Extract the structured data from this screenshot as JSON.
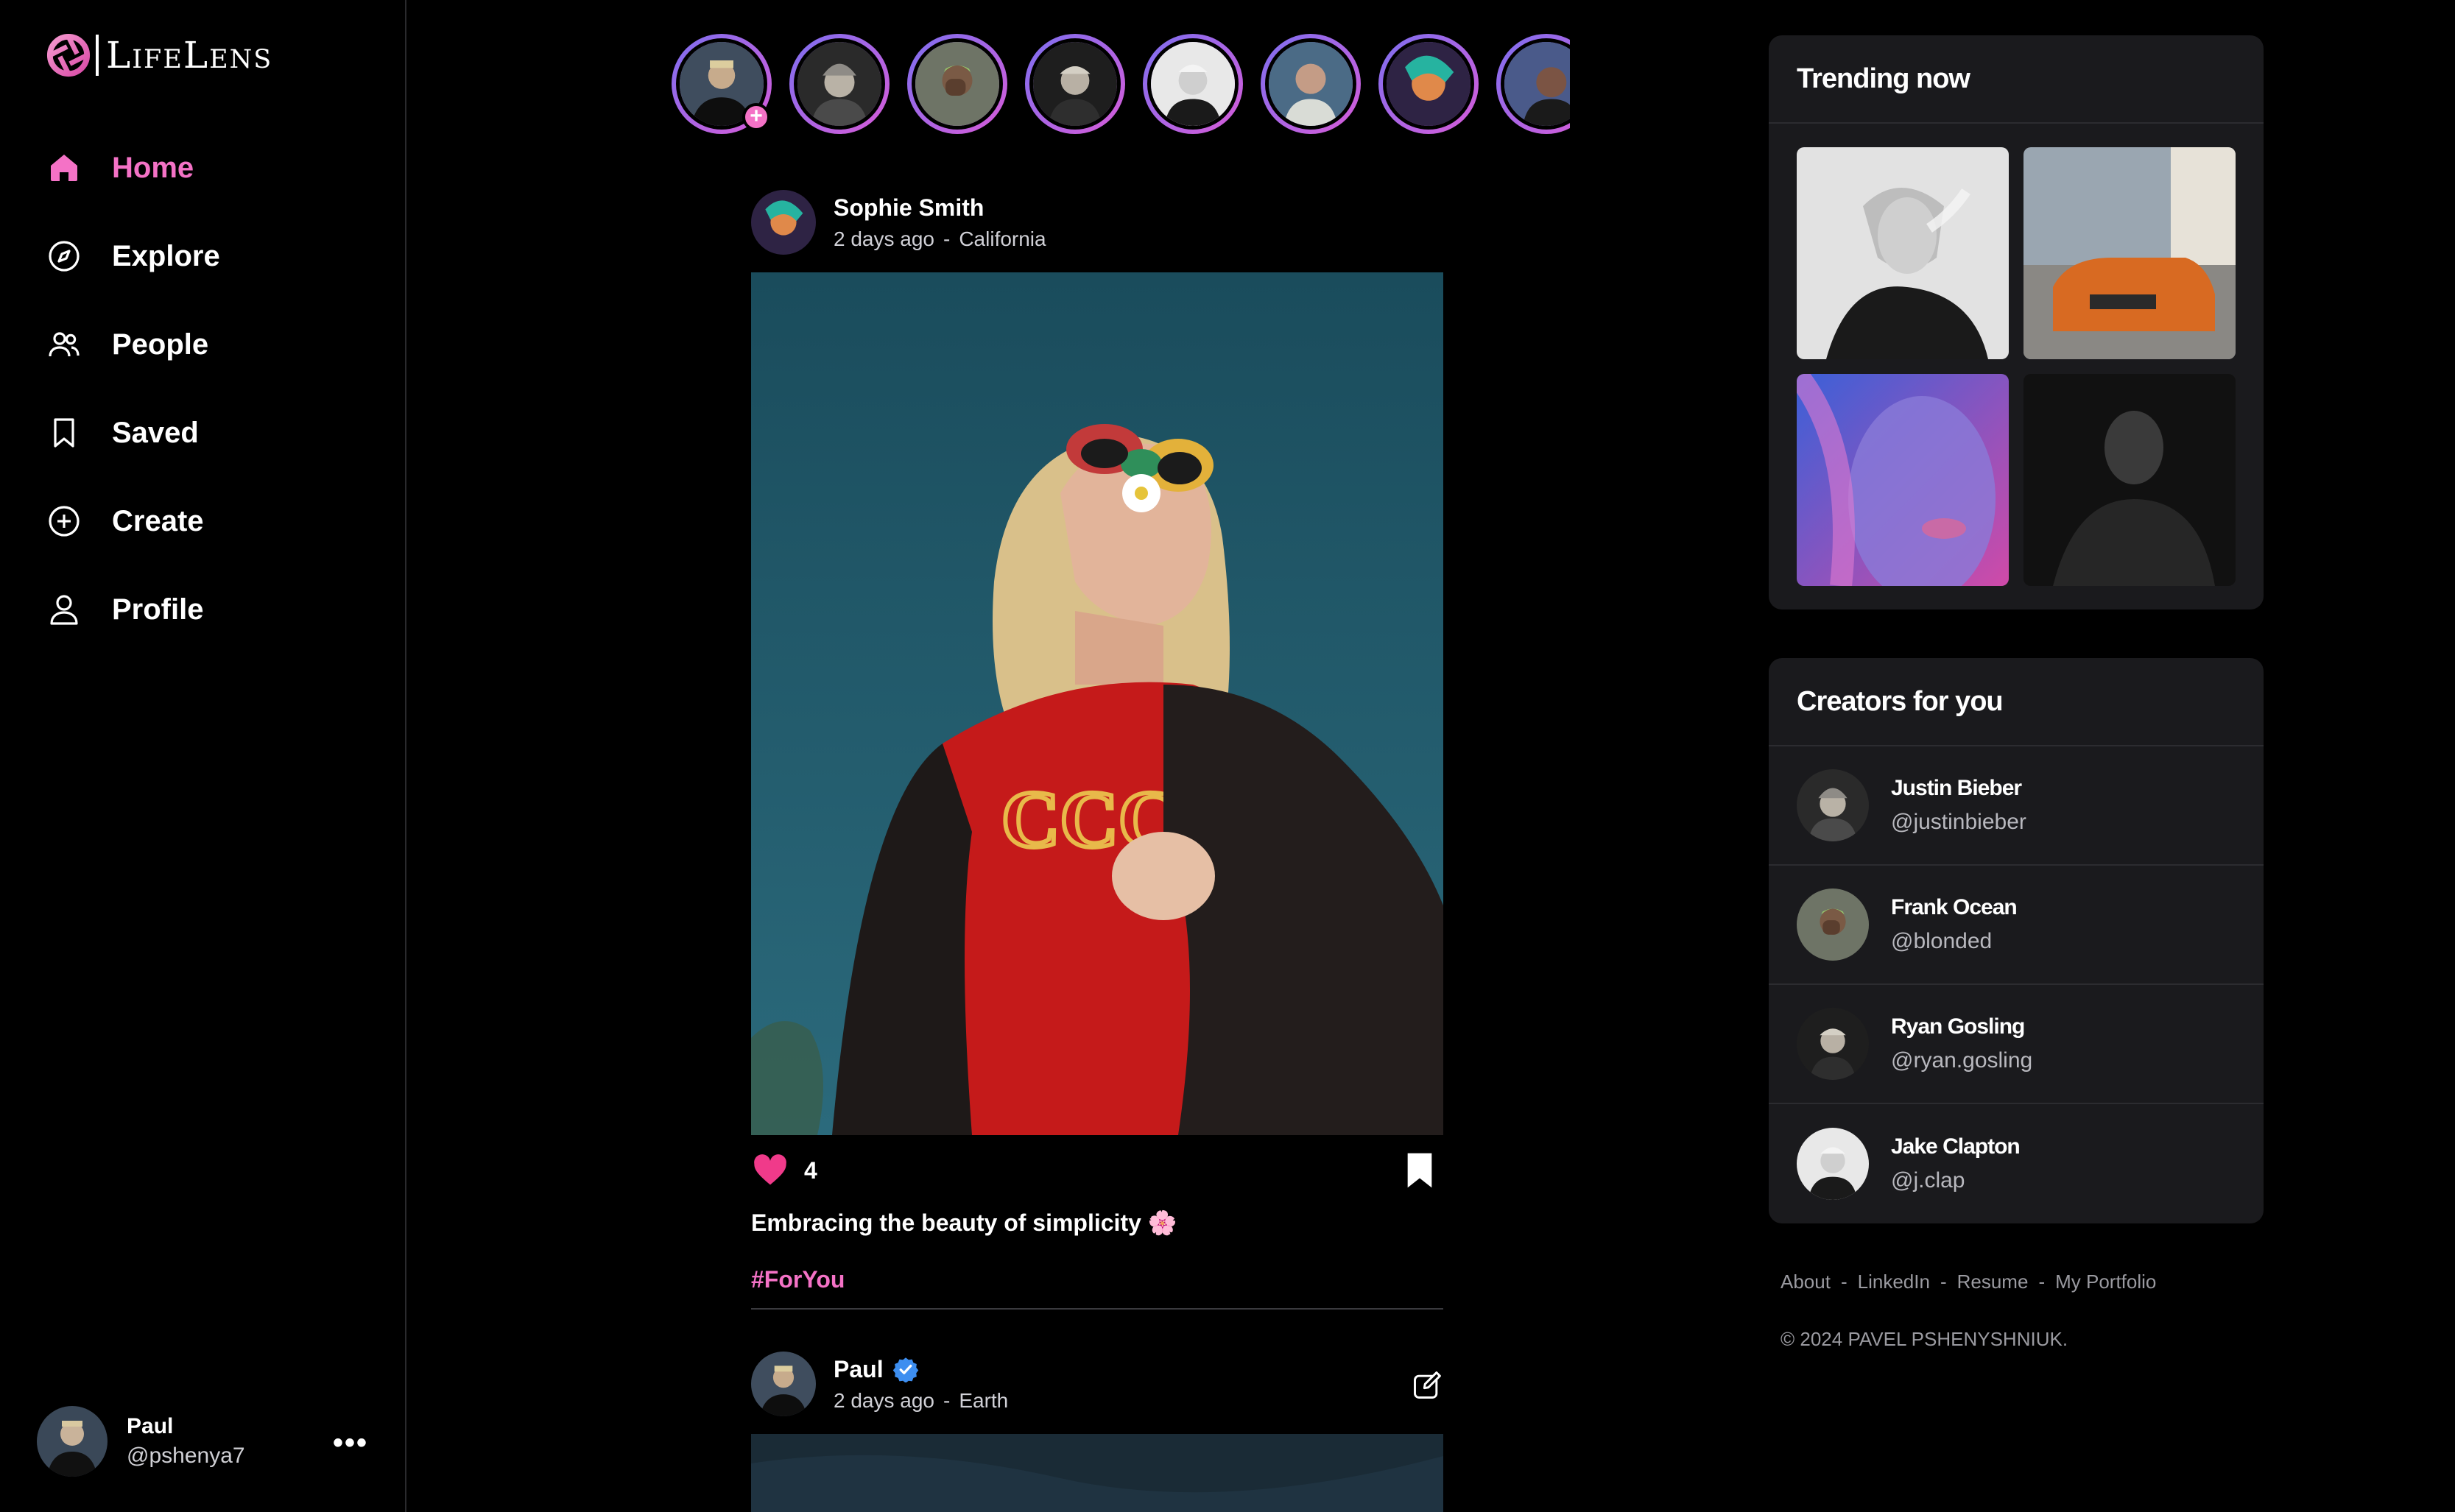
{
  "app": {
    "name": "LifeLens",
    "accent": "#f472c6"
  },
  "nav": {
    "items": [
      {
        "label": "Home",
        "icon": "home-icon",
        "active": true
      },
      {
        "label": "Explore",
        "icon": "compass-icon"
      },
      {
        "label": "People",
        "icon": "people-icon"
      },
      {
        "label": "Saved",
        "icon": "bookmark-icon"
      },
      {
        "label": "Create",
        "icon": "plus-circle-icon"
      },
      {
        "label": "Profile",
        "icon": "user-icon"
      }
    ]
  },
  "current_user": {
    "name": "Paul",
    "handle": "@pshenya7",
    "more": "•••"
  },
  "stories": {
    "add_label": "+"
  },
  "posts": [
    {
      "author": "Sophie Smith",
      "time": "2 days ago",
      "separator": "-",
      "location": "California",
      "likes": "4",
      "caption": "Embracing the beauty of simplicity 🌸",
      "hashtag": "#ForYou"
    },
    {
      "author": "Paul",
      "verified": true,
      "time": "2 days ago",
      "separator": "-",
      "location": "Earth"
    }
  ],
  "trending": {
    "title": "Trending now"
  },
  "creators": {
    "title": "Creators for you",
    "items": [
      {
        "name": "Justin Bieber",
        "handle": "@justinbieber"
      },
      {
        "name": "Frank Ocean",
        "handle": "@blonded"
      },
      {
        "name": "Ryan Gosling",
        "handle": "@ryan.gosling"
      },
      {
        "name": "Jake Clapton",
        "handle": "@j.clap"
      }
    ]
  },
  "footer": {
    "links": [
      "About",
      "LinkedIn",
      "Resume",
      "My Portfolio"
    ],
    "separator": "-",
    "copyright": "© 2024  PAVEL PSHENYSHNIUK."
  }
}
